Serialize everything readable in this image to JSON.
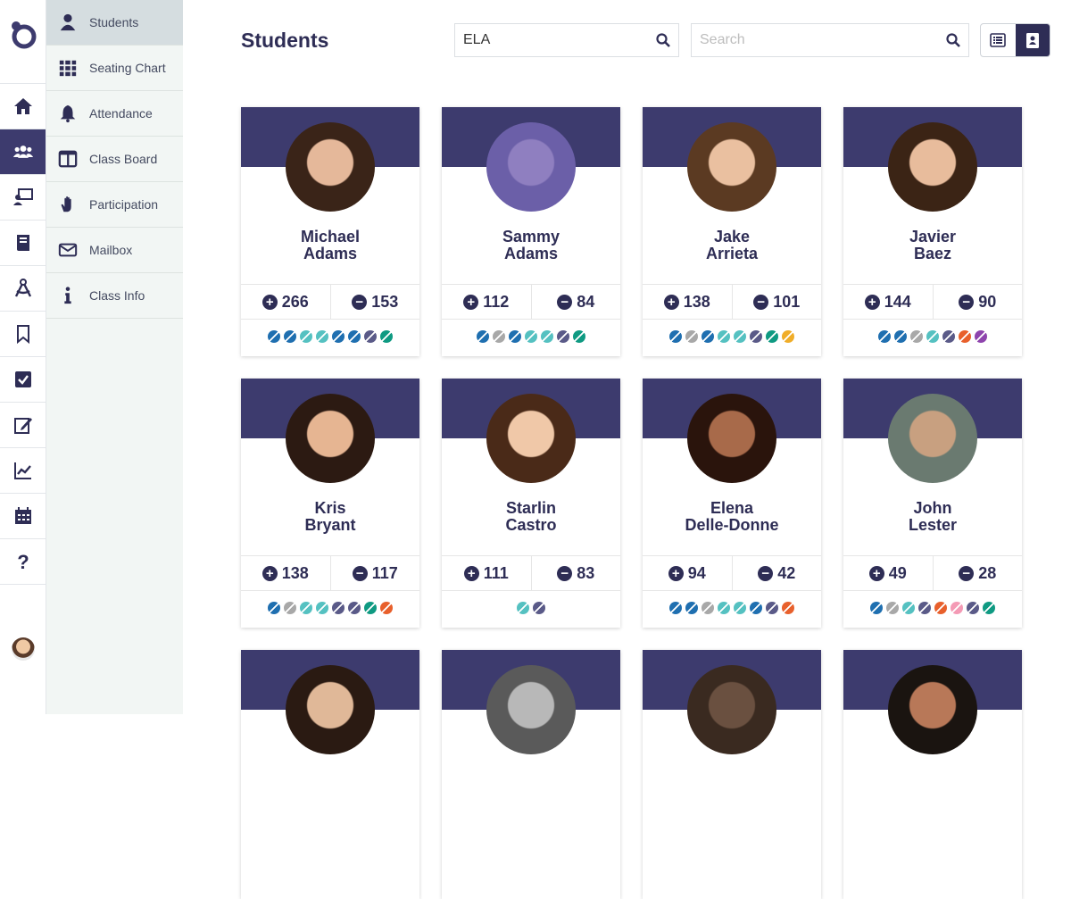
{
  "header": {
    "title": "Students"
  },
  "filter": {
    "value": "ELA"
  },
  "search": {
    "placeholder": "Search"
  },
  "submenu": [
    {
      "label": "Students",
      "icon": "person-icon",
      "active": true
    },
    {
      "label": "Seating Chart",
      "icon": "grid-icon"
    },
    {
      "label": "Attendance",
      "icon": "bell-icon"
    },
    {
      "label": "Class Board",
      "icon": "columns-icon"
    },
    {
      "label": "Participation",
      "icon": "hand-icon"
    },
    {
      "label": "Mailbox",
      "icon": "envelope-icon"
    },
    {
      "label": "Class Info",
      "icon": "info-icon"
    }
  ],
  "rail": [
    "home-icon",
    "users-icon",
    "presentation-icon",
    "book-icon",
    "compass-icon",
    "bookmark-icon",
    "checkbox-icon",
    "edit-icon",
    "chart-line-icon",
    "calendar-icon",
    "help-icon"
  ],
  "colors": {
    "primary": "#3d3b6e",
    "dark": "#2e2d55"
  },
  "students": [
    {
      "first": "Michael",
      "last": "Adams",
      "plus": "266",
      "minus": "153",
      "dots": [
        "#1f6fb0",
        "#1f6fb0",
        "#55c1c1",
        "#55c1c1",
        "#1f6fb0",
        "#1f6fb0",
        "#5a5a88",
        "#0f9a82"
      ]
    },
    {
      "first": "Sammy",
      "last": "Adams",
      "plus": "112",
      "minus": "84",
      "dots": [
        "#1f6fb0",
        "#a8a8a8",
        "#1f6fb0",
        "#55c1c1",
        "#55c1c1",
        "#5a5a88",
        "#0f9a82"
      ]
    },
    {
      "first": "Jake",
      "last": "Arrieta",
      "plus": "138",
      "minus": "101",
      "dots": [
        "#1f6fb0",
        "#a8a8a8",
        "#1f6fb0",
        "#55c1c1",
        "#55c1c1",
        "#5a5a88",
        "#0f9a82",
        "#f0ad28"
      ]
    },
    {
      "first": "Javier",
      "last": "Baez",
      "plus": "144",
      "minus": "90",
      "dots": [
        "#1f6fb0",
        "#1f6fb0",
        "#a8a8a8",
        "#55c1c1",
        "#5a5a88",
        "#e8602c",
        "#8e44ad"
      ]
    },
    {
      "first": "Kris",
      "last": "Bryant",
      "plus": "138",
      "minus": "117",
      "dots": [
        "#1f6fb0",
        "#a8a8a8",
        "#55c1c1",
        "#55c1c1",
        "#5a5a88",
        "#5a5a88",
        "#0f9a82",
        "#e8602c"
      ]
    },
    {
      "first": "Starlin",
      "last": "Castro",
      "plus": "111",
      "minus": "83",
      "dots": [
        "#55c1c1",
        "#5a5a88"
      ]
    },
    {
      "first": "Elena",
      "last": "Delle-Donne",
      "plus": "94",
      "minus": "42",
      "dots": [
        "#1f6fb0",
        "#1f6fb0",
        "#a8a8a8",
        "#55c1c1",
        "#55c1c1",
        "#1f6fb0",
        "#5a5a88",
        "#e8602c"
      ]
    },
    {
      "first": "John",
      "last": "Lester",
      "plus": "49",
      "minus": "28",
      "dots": [
        "#1f6fb0",
        "#a8a8a8",
        "#55c1c1",
        "#5a5a88",
        "#e8602c",
        "#f49ab5",
        "#5a5a88",
        "#0f9a82"
      ]
    },
    {
      "first": "",
      "last": "",
      "plus": "",
      "minus": "",
      "dots": []
    },
    {
      "first": "",
      "last": "",
      "plus": "",
      "minus": "",
      "dots": []
    },
    {
      "first": "",
      "last": "",
      "plus": "",
      "minus": "",
      "dots": []
    },
    {
      "first": "",
      "last": "",
      "plus": "",
      "minus": "",
      "dots": []
    }
  ]
}
